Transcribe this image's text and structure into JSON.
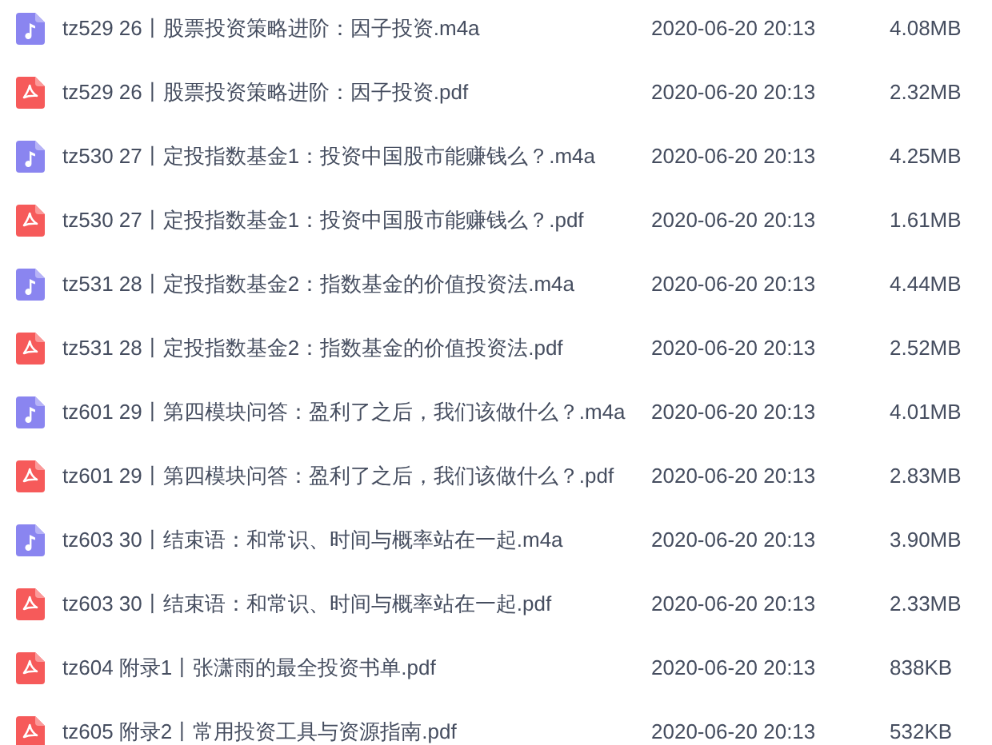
{
  "files": [
    {
      "kind": "audio",
      "name": "tz529 26丨股票投资策略进阶：因子投资.m4a",
      "modified": "2020-06-20 20:13",
      "size": "4.08MB"
    },
    {
      "kind": "pdf",
      "name": "tz529 26丨股票投资策略进阶：因子投资.pdf",
      "modified": "2020-06-20 20:13",
      "size": "2.32MB"
    },
    {
      "kind": "audio",
      "name": "tz530 27丨定投指数基金1：投资中国股市能赚钱么？.m4a",
      "modified": "2020-06-20 20:13",
      "size": "4.25MB"
    },
    {
      "kind": "pdf",
      "name": "tz530 27丨定投指数基金1：投资中国股市能赚钱么？.pdf",
      "modified": "2020-06-20 20:13",
      "size": "1.61MB"
    },
    {
      "kind": "audio",
      "name": "tz531 28丨定投指数基金2：指数基金的价值投资法.m4a",
      "modified": "2020-06-20 20:13",
      "size": "4.44MB"
    },
    {
      "kind": "pdf",
      "name": "tz531 28丨定投指数基金2：指数基金的价值投资法.pdf",
      "modified": "2020-06-20 20:13",
      "size": "2.52MB"
    },
    {
      "kind": "audio",
      "name": "tz601 29丨第四模块问答：盈利了之后，我们该做什么？.m4a",
      "modified": "2020-06-20 20:13",
      "size": "4.01MB"
    },
    {
      "kind": "pdf",
      "name": "tz601 29丨第四模块问答：盈利了之后，我们该做什么？.pdf",
      "modified": "2020-06-20 20:13",
      "size": "2.83MB"
    },
    {
      "kind": "audio",
      "name": "tz603 30丨结束语：和常识、时间与概率站在一起.m4a",
      "modified": "2020-06-20 20:13",
      "size": "3.90MB"
    },
    {
      "kind": "pdf",
      "name": "tz603 30丨结束语：和常识、时间与概率站在一起.pdf",
      "modified": "2020-06-20 20:13",
      "size": "2.33MB"
    },
    {
      "kind": "pdf",
      "name": "tz604 附录1丨张潇雨的最全投资书单.pdf",
      "modified": "2020-06-20 20:13",
      "size": "838KB"
    },
    {
      "kind": "pdf",
      "name": "tz605 附录2丨常用投资工具与资源指南.pdf",
      "modified": "2020-06-20 20:13",
      "size": "532KB"
    }
  ]
}
